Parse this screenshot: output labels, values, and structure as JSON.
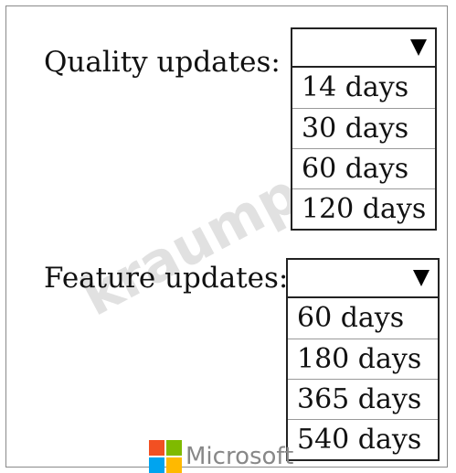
{
  "quality": {
    "label": "Quality updates:",
    "selected": "",
    "options": [
      "14 days",
      "30 days",
      "60 days",
      "120 days"
    ]
  },
  "feature": {
    "label": "Feature updates:",
    "selected": "",
    "options": [
      "60 days",
      "180 days",
      "365 days",
      "540 days"
    ]
  },
  "watermark": {
    "text": "kraump.com"
  },
  "footer": {
    "brand": "Microsoft",
    "logo_colors": [
      "#f25022",
      "#7fba00",
      "#00a4ef",
      "#ffb900"
    ]
  }
}
